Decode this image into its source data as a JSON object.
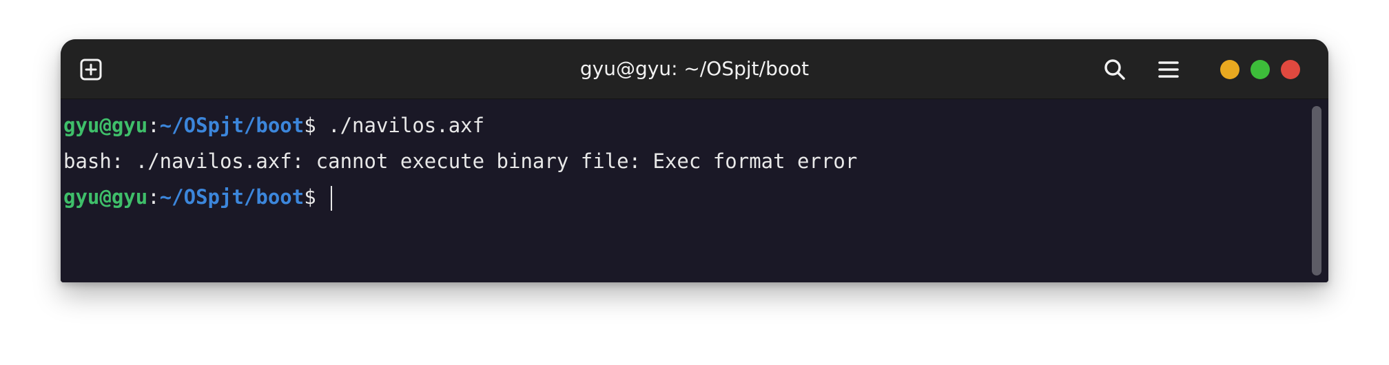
{
  "window": {
    "title": "gyu@gyu: ~/OSpjt/boot"
  },
  "titlebar": {
    "new_tab_icon": "new-tab-plus-icon",
    "search_icon": "search-icon",
    "menu_icon": "hamburger-menu-icon",
    "controls": {
      "minimize_color": "#e9a920",
      "maximize_color": "#3dbd3a",
      "close_color": "#e0493f"
    }
  },
  "terminal": {
    "lines": [
      {
        "user_host": "gyu@gyu",
        "separator": ":",
        "path": "~/OSpjt/boot",
        "prompt_char": "$",
        "command": " ./navilos.axf"
      },
      {
        "output": "bash: ./navilos.axf: cannot execute binary file: Exec format error"
      },
      {
        "user_host": "gyu@gyu",
        "separator": ":",
        "path": "~/OSpjt/boot",
        "prompt_char": "$",
        "command": " "
      }
    ],
    "colors": {
      "background": "#1a1826",
      "user_host": "#3fbf6a",
      "path": "#3c86db",
      "text": "#e8e8e8"
    }
  }
}
